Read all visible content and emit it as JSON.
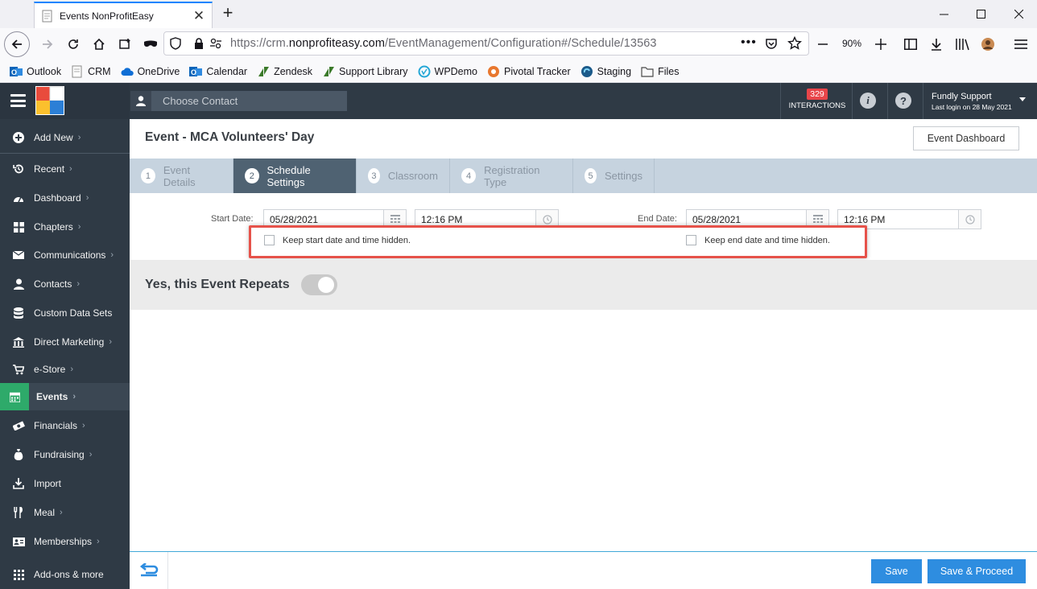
{
  "browser": {
    "tab_title": "Events NonProfitEasy",
    "url_prefix": "https://crm.",
    "url_domain": "nonprofiteasy.com",
    "url_path": "/EventManagement/Configuration#/Schedule/13563",
    "zoom": "90%",
    "bookmarks": [
      "Outlook",
      "CRM",
      "OneDrive",
      "Calendar",
      "Zendesk",
      "Support Library",
      "WPDemo",
      "Pivotal Tracker",
      "Staging",
      "Files"
    ]
  },
  "topbar": {
    "contact_placeholder": "Choose Contact",
    "interactions_count": "329",
    "interactions_label": "INTERACTIONS",
    "user_name": "Fundly Support",
    "last_login": "Last login on 28 May 2021"
  },
  "sidebar": {
    "items": [
      {
        "label": "Add New",
        "icon": "plus-circle-icon"
      },
      {
        "label": "Recent",
        "icon": "history-icon"
      },
      {
        "label": "Dashboard",
        "icon": "dashboard-icon"
      },
      {
        "label": "Chapters",
        "icon": "grid-icon"
      },
      {
        "label": "Communications",
        "icon": "envelope-icon"
      },
      {
        "label": "Contacts",
        "icon": "person-icon"
      },
      {
        "label": "Custom Data Sets",
        "icon": "database-icon"
      },
      {
        "label": "Direct Marketing",
        "icon": "bank-icon"
      },
      {
        "label": "e-Store",
        "icon": "cart-icon"
      },
      {
        "label": "Events",
        "icon": "calendar-icon"
      },
      {
        "label": "Financials",
        "icon": "money-icon"
      },
      {
        "label": "Fundraising",
        "icon": "money-bag-icon"
      },
      {
        "label": "Import",
        "icon": "download-icon"
      },
      {
        "label": "Meal",
        "icon": "cutlery-icon"
      },
      {
        "label": "Memberships",
        "icon": "id-card-icon"
      },
      {
        "label": "Add-ons & more",
        "icon": "apps-icon"
      }
    ]
  },
  "main": {
    "title": "Event - MCA Volunteers' Day",
    "dashboard_button": "Event Dashboard",
    "steps": [
      {
        "num": "1",
        "label": "Event Details"
      },
      {
        "num": "2",
        "label": "Schedule Settings"
      },
      {
        "num": "3",
        "label": "Classroom"
      },
      {
        "num": "4",
        "label": "Registration Type"
      },
      {
        "num": "5",
        "label": "Settings"
      }
    ],
    "active_step": "Schedule Settings",
    "start_label": "Start Date:",
    "start_date": "05/28/2021",
    "start_time": "12:16 PM",
    "end_label": "End Date:",
    "end_date": "05/28/2021",
    "end_time": "12:16 PM",
    "keep_start_hidden": "Keep start date and time hidden.",
    "keep_end_hidden": "Keep end date and time hidden.",
    "repeats_label": "Yes, this Event Repeats",
    "repeats_on": false
  },
  "footer": {
    "save": "Save",
    "save_proceed": "Save & Proceed"
  },
  "colors": {
    "sidebar_bg": "#2f3a45",
    "active_green": "#2eaa6a",
    "primary_blue": "#2e8de0",
    "highlight_red": "#e6524a",
    "badge_red": "#e8454a"
  }
}
